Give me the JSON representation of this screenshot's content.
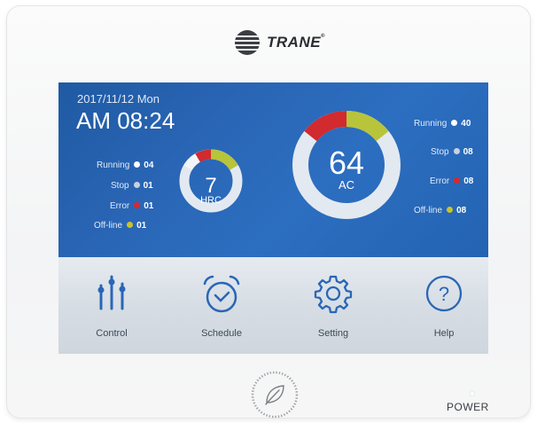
{
  "brand": {
    "name": "TRANE",
    "mark": "®"
  },
  "screen": {
    "date": "2017/11/12  Mon",
    "time": "AM 08:24",
    "hrc": {
      "count": "7",
      "label": "HRC",
      "stats": [
        {
          "label": "Running",
          "value": "04",
          "color": "#ffffff"
        },
        {
          "label": "Stop",
          "value": "01",
          "color": "#c8d2de"
        },
        {
          "label": "Error",
          "value": "01",
          "color": "#d7282f"
        },
        {
          "label": "Off-line",
          "value": "01",
          "color": "#c9c42a"
        }
      ]
    },
    "ac": {
      "count": "64",
      "label": "AC",
      "stats": [
        {
          "label": "Running",
          "value": "40",
          "color": "#ffffff"
        },
        {
          "label": "Stop",
          "value": "08",
          "color": "#c8d2de"
        },
        {
          "label": "Error",
          "value": "08",
          "color": "#d7282f"
        },
        {
          "label": "Off-line",
          "value": "08",
          "color": "#c9c42a"
        }
      ]
    },
    "nav": [
      {
        "label": "Control",
        "icon": "sliders-icon"
      },
      {
        "label": "Schedule",
        "icon": "alarm-clock-icon"
      },
      {
        "label": "Setting",
        "icon": "gear-icon"
      },
      {
        "label": "Help",
        "icon": "question-icon"
      }
    ]
  },
  "hardware": {
    "power_label": "POWER",
    "home_button_icon": "leaf-icon"
  },
  "colors": {
    "screen_blue": "#2a66b6",
    "error": "#d7282f",
    "offline": "#c9c42a",
    "icon_blue": "#2a66b6"
  }
}
